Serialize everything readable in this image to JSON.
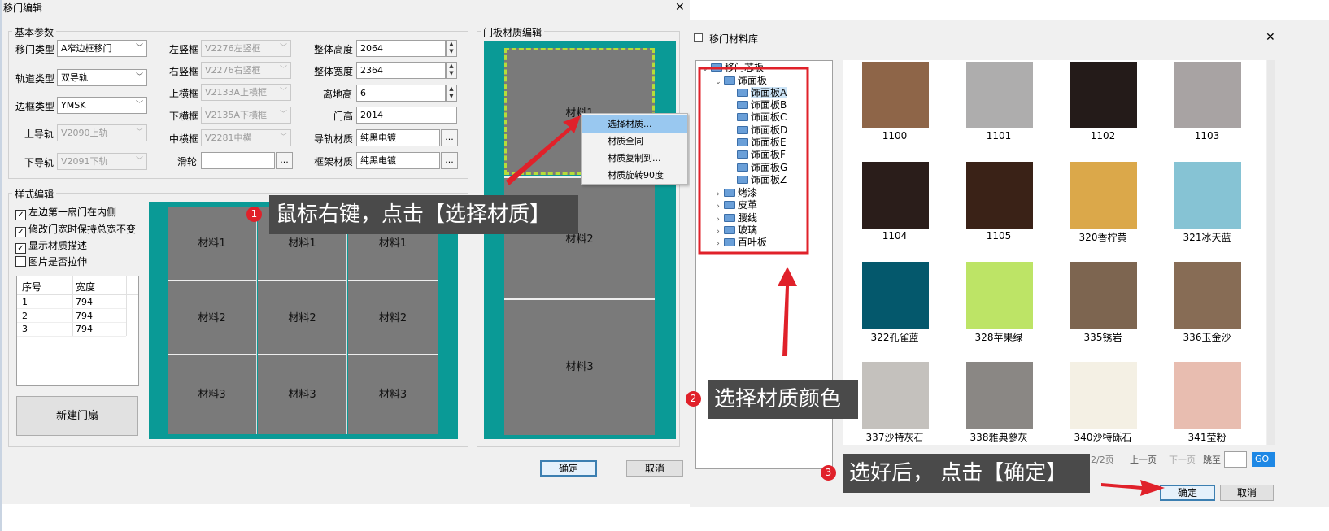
{
  "dialog1": {
    "title": "移门编辑",
    "close": "✕",
    "basic": {
      "title": "基本参数",
      "door_type": {
        "label": "移门类型",
        "value": "A窄边框移门"
      },
      "track_type": {
        "label": "轨道类型",
        "value": "双导轨"
      },
      "frame_type": {
        "label": "边框类型",
        "value": "YMSK"
      },
      "upper_rail": {
        "label": "上导轨",
        "value": "V2090上轨"
      },
      "lower_rail": {
        "label": "下导轨",
        "value": "V2091下轨"
      },
      "left_stile": {
        "label": "左竖框",
        "value": "V2276左竖框"
      },
      "right_stile": {
        "label": "右竖框",
        "value": "V2276右竖框"
      },
      "top_rail": {
        "label": "上横框",
        "value": "V2133A上横框"
      },
      "bottom_rail": {
        "label": "下横框",
        "value": "V2135A下横框"
      },
      "mid_rail": {
        "label": "中横框",
        "value": "V2281中横"
      },
      "pulley": {
        "label": "滑轮",
        "value": ""
      },
      "total_height": {
        "label": "整体高度",
        "value": "2064"
      },
      "total_width": {
        "label": "整体宽度",
        "value": "2364"
      },
      "ground_clearance": {
        "label": "离地高",
        "value": "6"
      },
      "door_height": {
        "label": "门高",
        "value": "2014"
      },
      "rail_material": {
        "label": "导轨材质",
        "value": "纯黑电镀"
      },
      "frame_material": {
        "label": "框架材质",
        "value": "纯黑电镀"
      },
      "dots": "..."
    },
    "style": {
      "title": "样式编辑",
      "checks": [
        {
          "label": "左边第一扇门在内侧",
          "checked": true
        },
        {
          "label": "修改门宽时保持总宽不变",
          "checked": true
        },
        {
          "label": "显示材质描述",
          "checked": true
        },
        {
          "label": "图片是否拉伸",
          "checked": false
        }
      ],
      "table": {
        "headers": [
          "序号",
          "宽度"
        ],
        "rows": [
          [
            "1",
            "794"
          ],
          [
            "2",
            "794"
          ],
          [
            "3",
            "794"
          ]
        ]
      },
      "new_panel_button": "新建门扇",
      "preview_cells": [
        "材料1",
        "材料1",
        "材料1",
        "材料2",
        "材料2",
        "材料2",
        "材料3",
        "材料3",
        "材料3"
      ]
    },
    "panel_edit": {
      "title": "门板材质编辑",
      "cells": [
        "材料1",
        "材料2",
        "材料3"
      ]
    },
    "context_menu": [
      "选择材质...",
      "材质全同",
      "材质复制到...",
      "材质旋转90度"
    ],
    "ok": "确定",
    "cancel": "取消"
  },
  "dialog2": {
    "title": "移门材料库",
    "close": "✕",
    "tree": {
      "root": "移门芯板",
      "group": "饰面板",
      "children": [
        "饰面板A",
        "饰面板B",
        "饰面板C",
        "饰面板D",
        "饰面板E",
        "饰面板F",
        "饰面板G",
        "饰面板Z"
      ],
      "siblings": [
        "烤漆",
        "皮革",
        "腰线",
        "玻璃",
        "百叶板"
      ]
    },
    "swatches": [
      {
        "name": "1100",
        "color": "#8e6548"
      },
      {
        "name": "1101",
        "color": "#aeadad"
      },
      {
        "name": "1102",
        "color": "#241b19"
      },
      {
        "name": "1103",
        "color": "#a8a3a3"
      },
      {
        "name": "1104",
        "color": "#2a1d1a"
      },
      {
        "name": "1105",
        "color": "#3a2217"
      },
      {
        "name": "320香柠黄",
        "color": "#dba84a"
      },
      {
        "name": "321冰天蓝",
        "color": "#86c3d4"
      },
      {
        "name": "322孔雀蓝",
        "color": "#04586c"
      },
      {
        "name": "328苹果绿",
        "color": "#bde466"
      },
      {
        "name": "335锈岩",
        "color": "#7d6550"
      },
      {
        "name": "336玉金沙",
        "color": "#876c55"
      },
      {
        "name": "337沙特灰石",
        "color": "#c4c1bd"
      },
      {
        "name": "338雅典蓼灰",
        "color": "#8a8784"
      },
      {
        "name": "340沙特砾石",
        "color": "#f4f0e4"
      },
      {
        "name": "341莹粉",
        "color": "#e8bdb0"
      }
    ],
    "pager": {
      "page": "2/2页",
      "prev": "上一页",
      "next": "下一页",
      "jump": "跳至",
      "go": "GO"
    },
    "ok": "确定",
    "cancel": "取消"
  },
  "annotations": [
    {
      "num": "1",
      "text": "鼠标右键，点击【选择材质】"
    },
    {
      "num": "2",
      "text": "选择材质颜色"
    },
    {
      "num": "3",
      "text": "选好后， 点击【确定】"
    }
  ],
  "colors": {
    "teal": "#0a9a96",
    "panel": "#7a7a7a",
    "red": "#e0212a",
    "callout": "#4a4a4a",
    "dialog_bg": "#f0f0f0"
  }
}
